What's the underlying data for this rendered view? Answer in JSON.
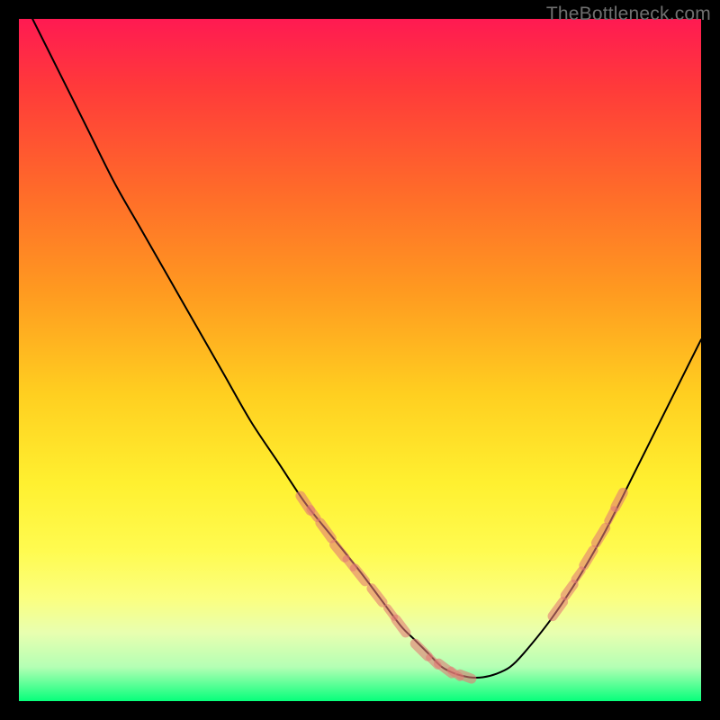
{
  "watermark": "TheBottleneck.com",
  "gradient_stops": [
    {
      "offset": 0.0,
      "color": "#ff1a52"
    },
    {
      "offset": 0.1,
      "color": "#ff3a3a"
    },
    {
      "offset": 0.25,
      "color": "#ff6a2a"
    },
    {
      "offset": 0.4,
      "color": "#ff9a20"
    },
    {
      "offset": 0.55,
      "color": "#ffcf20"
    },
    {
      "offset": 0.68,
      "color": "#fff030"
    },
    {
      "offset": 0.78,
      "color": "#fffb50"
    },
    {
      "offset": 0.85,
      "color": "#fbff80"
    },
    {
      "offset": 0.9,
      "color": "#e8ffb0"
    },
    {
      "offset": 0.95,
      "color": "#b4ffb4"
    },
    {
      "offset": 1.0,
      "color": "#07ff7b"
    }
  ],
  "marker_color": "#e37a75",
  "marker_alpha": 0.6,
  "curve_color": "#000000",
  "chart_data": {
    "type": "line",
    "title": "",
    "xlabel": "",
    "ylabel": "",
    "xlim": [
      0,
      100
    ],
    "ylim": [
      0,
      100
    ],
    "grid": false,
    "legend": false,
    "series": [
      {
        "name": "curve",
        "x": [
          2,
          6,
          10,
          14,
          18,
          22,
          26,
          30,
          34,
          38,
          42,
          46,
          50,
          53,
          56,
          58,
          60,
          62,
          64,
          66,
          68,
          70,
          72,
          74,
          78,
          82,
          86,
          90,
          94,
          98,
          100
        ],
        "y": [
          100,
          92,
          84,
          76,
          69,
          62,
          55,
          48,
          41,
          35,
          29,
          24,
          19,
          15,
          11,
          9,
          7,
          5,
          4,
          3.5,
          3.5,
          4,
          5,
          7,
          12,
          18,
          25,
          33,
          41,
          49,
          53
        ]
      }
    ],
    "markers": [
      {
        "x": 42,
        "y": 29,
        "len": 2.6,
        "thick": true
      },
      {
        "x": 43.2,
        "y": 27.5,
        "len": 1.6,
        "thick": false
      },
      {
        "x": 45,
        "y": 25,
        "len": 2.8,
        "thick": true
      },
      {
        "x": 47,
        "y": 22,
        "len": 2.4,
        "thick": true
      },
      {
        "x": 48.5,
        "y": 20.2,
        "len": 1.5,
        "thick": false
      },
      {
        "x": 50,
        "y": 18.5,
        "len": 2.4,
        "thick": true
      },
      {
        "x": 52.5,
        "y": 15.5,
        "len": 2.6,
        "thick": true
      },
      {
        "x": 54.5,
        "y": 13,
        "len": 1.6,
        "thick": false
      },
      {
        "x": 56,
        "y": 11,
        "len": 2.4,
        "thick": true
      },
      {
        "x": 59,
        "y": 7.5,
        "len": 2.6,
        "thick": true
      },
      {
        "x": 60.8,
        "y": 5.8,
        "len": 1.6,
        "thick": false
      },
      {
        "x": 62.5,
        "y": 4.8,
        "len": 2.4,
        "thick": true
      },
      {
        "x": 64,
        "y": 4,
        "len": 1.6,
        "thick": false
      },
      {
        "x": 65.5,
        "y": 3.6,
        "len": 1.8,
        "thick": true
      },
      {
        "x": 79,
        "y": 13.5,
        "len": 2.6,
        "thick": true
      },
      {
        "x": 80.7,
        "y": 16.3,
        "len": 2.0,
        "thick": true
      },
      {
        "x": 82,
        "y": 18.5,
        "len": 1.6,
        "thick": false
      },
      {
        "x": 83.5,
        "y": 21,
        "len": 2.6,
        "thick": true
      },
      {
        "x": 85.3,
        "y": 24.3,
        "len": 2.6,
        "thick": true
      },
      {
        "x": 86.8,
        "y": 27.2,
        "len": 1.8,
        "thick": false
      },
      {
        "x": 88,
        "y": 29.5,
        "len": 2.4,
        "thick": true
      }
    ]
  }
}
